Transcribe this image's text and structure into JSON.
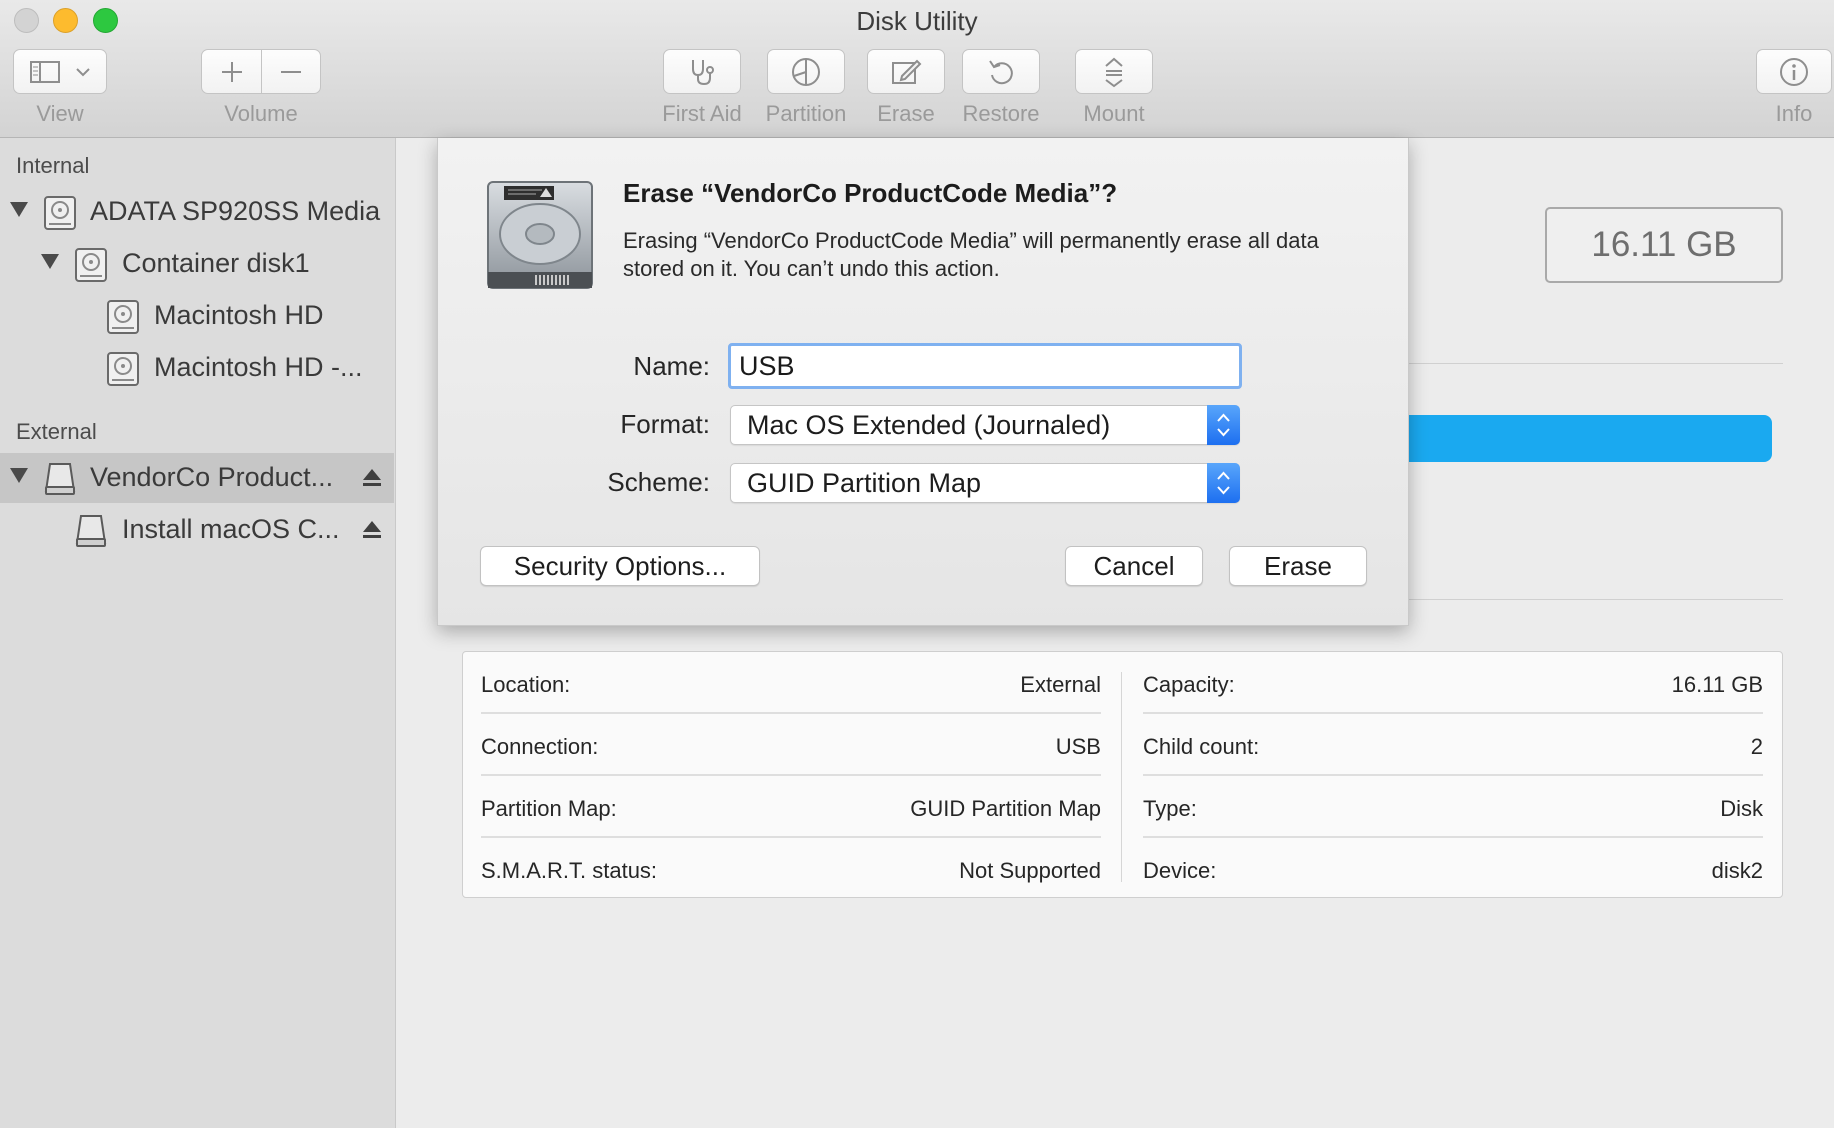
{
  "window": {
    "title": "Disk Utility"
  },
  "toolbar": {
    "view_label": "View",
    "volume_label": "Volume",
    "first_aid_label": "First Aid",
    "partition_label": "Partition",
    "erase_label": "Erase",
    "restore_label": "Restore",
    "mount_label": "Mount",
    "info_label": "Info"
  },
  "sidebar": {
    "internal_header": "Internal",
    "external_header": "External",
    "items": [
      {
        "label": "ADATA SP920SS Media",
        "icon": "internal-disk-icon"
      },
      {
        "label": "Container disk1",
        "icon": "internal-disk-icon"
      },
      {
        "label": "Macintosh HD",
        "icon": "internal-disk-icon"
      },
      {
        "label": "Macintosh HD -...",
        "icon": "internal-disk-icon"
      },
      {
        "label": "VendorCo Product...",
        "icon": "external-disk-icon",
        "selected": true
      },
      {
        "label": "Install macOS C...",
        "icon": "external-disk-icon"
      }
    ]
  },
  "main": {
    "capacity": "16.11 GB",
    "usage_color": "#1aa9f0",
    "info": {
      "left": [
        {
          "key": "Location:",
          "value": "External"
        },
        {
          "key": "Connection:",
          "value": "USB"
        },
        {
          "key": "Partition Map:",
          "value": "GUID Partition Map"
        },
        {
          "key": "S.M.A.R.T. status:",
          "value": "Not Supported"
        }
      ],
      "right": [
        {
          "key": "Capacity:",
          "value": "16.11 GB"
        },
        {
          "key": "Child count:",
          "value": "2"
        },
        {
          "key": "Type:",
          "value": "Disk"
        },
        {
          "key": "Device:",
          "value": "disk2"
        }
      ]
    }
  },
  "dialog": {
    "title": "Erase “VendorCo ProductCode Media”?",
    "message": "Erasing “VendorCo ProductCode Media” will permanently erase all data stored on it. You can’t undo this action.",
    "name_label": "Name:",
    "name_value": "USB",
    "format_label": "Format:",
    "format_value": "Mac OS Extended (Journaled)",
    "scheme_label": "Scheme:",
    "scheme_value": "GUID Partition Map",
    "security_button": "Security Options...",
    "cancel_button": "Cancel",
    "erase_button": "Erase"
  }
}
